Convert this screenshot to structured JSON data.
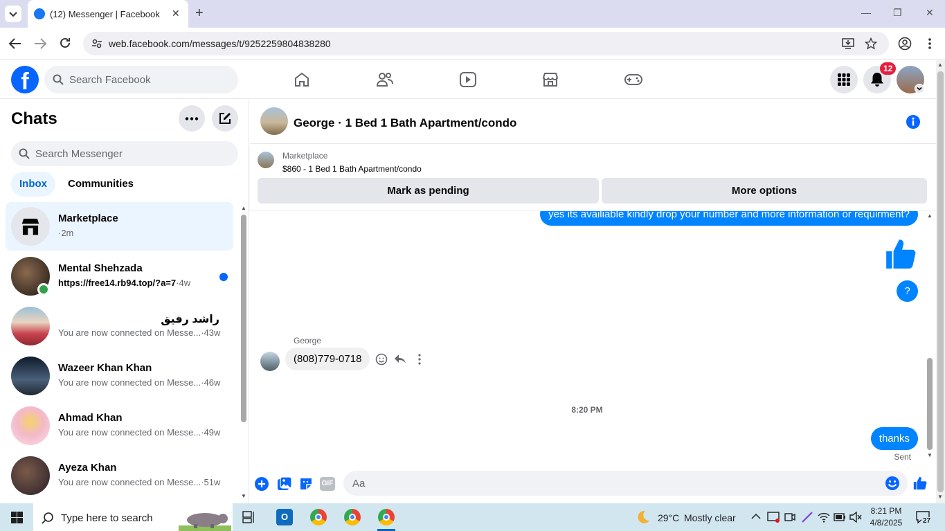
{
  "browser": {
    "tab_title": "(12) Messenger | Facebook",
    "url": "web.facebook.com/messages/t/9252259804838280"
  },
  "fb": {
    "search_placeholder": "Search Facebook",
    "notifications_count": "12"
  },
  "chats": {
    "title": "Chats",
    "search_placeholder": "Search Messenger",
    "tabs": [
      "Inbox",
      "Communities"
    ],
    "items": [
      {
        "name": "Marketplace",
        "preview": "",
        "ago": "·2m",
        "avatar_color": "#e4e6eb",
        "selected": true
      },
      {
        "name": "Mental Shehzada",
        "preview": "https://free14.rb94.top/?a=7",
        "ago": "·4w",
        "avatar_color": "#3a2e25",
        "unread": true
      },
      {
        "name": "راشد رفیق",
        "preview": "You are now connected on Messe...",
        "ago": "·43w",
        "avatar_color": "#c8414e"
      },
      {
        "name": "Wazeer Khan Khan",
        "preview": "You are now connected on Messe...",
        "ago": "·46w",
        "avatar_color": "#2e3b4e"
      },
      {
        "name": "Ahmad Khan",
        "preview": "You are now connected on Messe...",
        "ago": "·49w",
        "avatar_color": "#f3b9c9"
      },
      {
        "name": "Ayeza Khan",
        "preview": "You are now connected on Messe...",
        "ago": "·51w",
        "avatar_color": "#3c2f36"
      }
    ]
  },
  "conversation": {
    "title": "George · 1 Bed 1 Bath Apartment/condo",
    "marketplace_label": "Marketplace",
    "listing": "$860 - 1 Bed 1 Bath Apartment/condo",
    "mark_pending": "Mark as pending",
    "more_options": "More options",
    "messages": {
      "out_1": "yes its availiable  kindly  drop your number and more information or requirment?",
      "out_question": "?",
      "sender_name": "George",
      "in_phone": "(808)779-0718",
      "time_divider": "8:20 PM",
      "out_thanks": "thanks",
      "status": "Sent"
    },
    "composer_placeholder": "Aa",
    "gif_label": "GIF"
  },
  "taskbar": {
    "search_placeholder": "Type here to search",
    "weather_temp": "29°C",
    "weather_desc": "Mostly clear",
    "time": "8:21 PM",
    "date": "4/8/2025",
    "notif_count": "27"
  },
  "colors": {
    "fb_blue": "#0866ff",
    "messenger_blue": "#0084ff",
    "selected_row": "#ebf5ff"
  }
}
